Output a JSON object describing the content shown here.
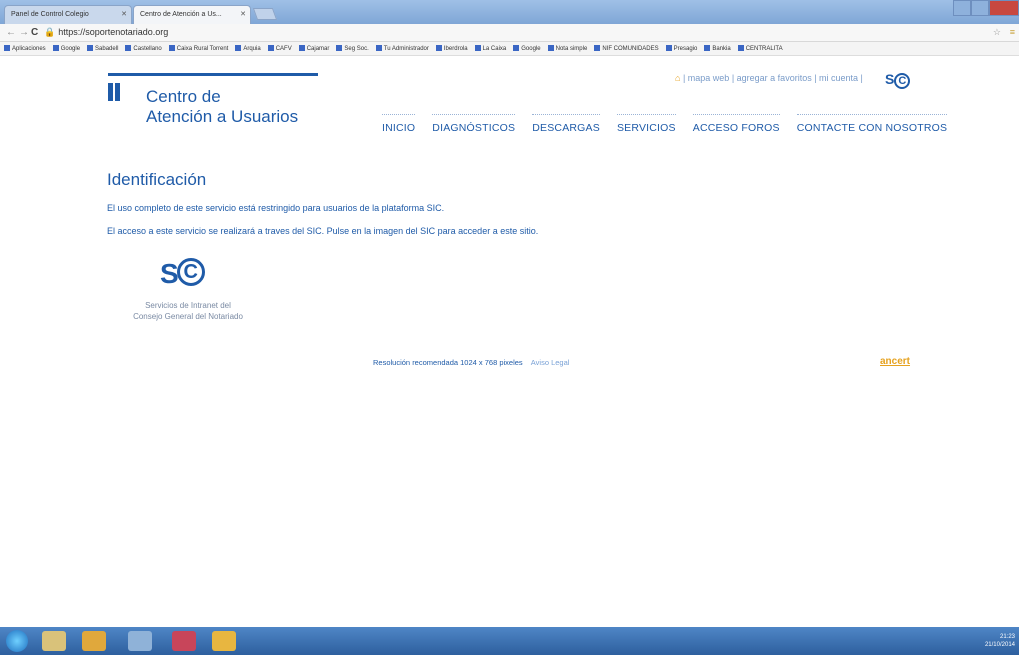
{
  "browser": {
    "tabs": [
      {
        "label": "Panel de Control Colegio"
      },
      {
        "label": "Centro de Atención a Us..."
      }
    ],
    "url": "https://soportenotariado.org",
    "bookmarks": [
      "Aplicaciones",
      "Google",
      "Sabadell",
      "Castellano",
      "Caixa Rural Torrent",
      "Arquia",
      "CAFV",
      "Cajamar",
      "Seg Soc.",
      "Tu Administrador",
      "Iberdrola",
      "La Caixa",
      "Google",
      "Nota simple",
      "NIF COMUNIDADES",
      "Presagio",
      "Bankia",
      "CENTRALITA"
    ]
  },
  "header": {
    "logo_line1": "Centro de",
    "logo_line2": "Atención a Usuarios",
    "top_links": "| mapa web | agregar a favoritos | mi cuenta |",
    "sic_small": "SIC"
  },
  "nav": [
    "INICIO",
    "DIAGNÓSTICOS",
    "DESCARGAS",
    "SERVICIOS",
    "ACCESO FOROS",
    "CONTACTE CON NOSOTROS"
  ],
  "main": {
    "title": "Identificación",
    "p1": "El uso completo de este servicio está restringido para usuarios de la plataforma SIC.",
    "p2": "El acceso a este servicio se realizará a traves del SIC. Pulse en la imagen del SIC para acceder a este sitio.",
    "sic_caption_1": "Servicios de Intranet del",
    "sic_caption_2": "Consejo General del Notariado"
  },
  "footer": {
    "resolution": "Resolución recomendada 1024 x 768 pixeles",
    "legal": "Aviso Legal",
    "ancert": "ancert"
  },
  "taskbar": {
    "time": "21:23",
    "date": "21/10/2014"
  }
}
